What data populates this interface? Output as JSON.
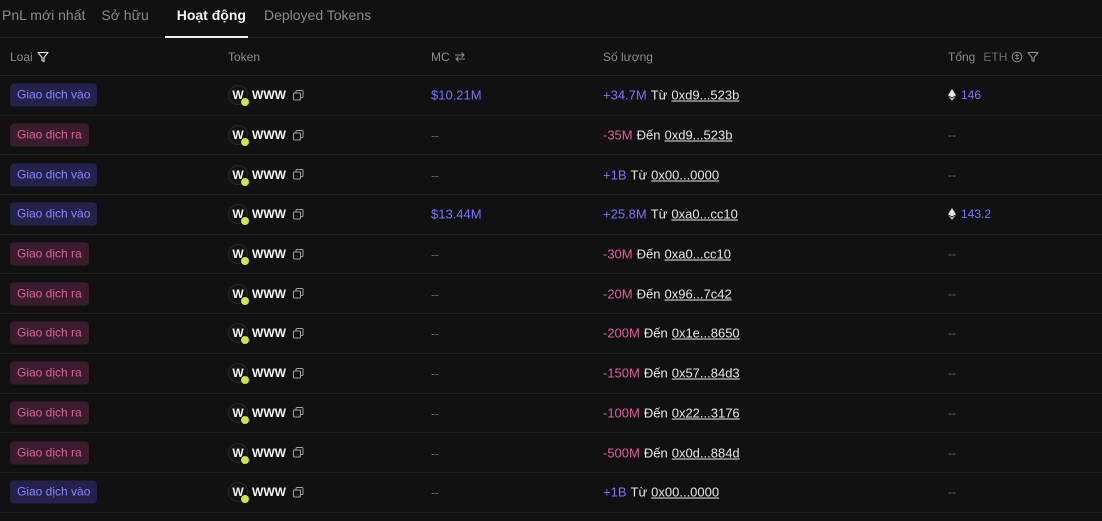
{
  "tabs": [
    {
      "label": "PnL mới nhất",
      "active": false
    },
    {
      "label": "Sở hữu",
      "active": false
    },
    {
      "label": "Hoạt động",
      "active": true
    },
    {
      "label": "Deployed Tokens",
      "active": false
    }
  ],
  "headers": {
    "type": "Loại",
    "token": "Token",
    "mc": "MC",
    "qty": "Số lượng",
    "total": "Tổng",
    "total_unit": "ETH"
  },
  "colors": {
    "in": "#7a73ff",
    "out": "#e0609a",
    "background": "#111112"
  },
  "rows": [
    {
      "type": "Giao dịch vào",
      "kind": "in",
      "token": "WWW",
      "mc": "$10.21M",
      "amount": "+34.7M",
      "dir": "Từ",
      "addr": "0xd9...523b",
      "total": "146"
    },
    {
      "type": "Giao dịch ra",
      "kind": "out",
      "token": "WWW",
      "mc": "--",
      "amount": "-35M",
      "dir": "Đến",
      "addr": "0xd9...523b",
      "total": "--"
    },
    {
      "type": "Giao dịch vào",
      "kind": "in",
      "token": "WWW",
      "mc": "--",
      "amount": "+1B",
      "dir": "Từ",
      "addr": "0x00...0000",
      "total": "--"
    },
    {
      "type": "Giao dịch vào",
      "kind": "in",
      "token": "WWW",
      "mc": "$13.44M",
      "amount": "+25.8M",
      "dir": "Từ",
      "addr": "0xa0...cc10",
      "total": "143.2"
    },
    {
      "type": "Giao dịch ra",
      "kind": "out",
      "token": "WWW",
      "mc": "--",
      "amount": "-30M",
      "dir": "Đến",
      "addr": "0xa0...cc10",
      "total": "--"
    },
    {
      "type": "Giao dịch ra",
      "kind": "out",
      "token": "WWW",
      "mc": "--",
      "amount": "-20M",
      "dir": "Đến",
      "addr": "0x96...7c42",
      "total": "--"
    },
    {
      "type": "Giao dịch ra",
      "kind": "out",
      "token": "WWW",
      "mc": "--",
      "amount": "-200M",
      "dir": "Đến",
      "addr": "0x1e...8650",
      "total": "--"
    },
    {
      "type": "Giao dịch ra",
      "kind": "out",
      "token": "WWW",
      "mc": "--",
      "amount": "-150M",
      "dir": "Đến",
      "addr": "0x57...84d3",
      "total": "--"
    },
    {
      "type": "Giao dịch ra",
      "kind": "out",
      "token": "WWW",
      "mc": "--",
      "amount": "-100M",
      "dir": "Đến",
      "addr": "0x22...3176",
      "total": "--"
    },
    {
      "type": "Giao dịch ra",
      "kind": "out",
      "token": "WWW",
      "mc": "--",
      "amount": "-500M",
      "dir": "Đến",
      "addr": "0x0d...884d",
      "total": "--"
    },
    {
      "type": "Giao dịch vào",
      "kind": "in",
      "token": "WWW",
      "mc": "--",
      "amount": "+1B",
      "dir": "Từ",
      "addr": "0x00...0000",
      "total": "--"
    }
  ]
}
